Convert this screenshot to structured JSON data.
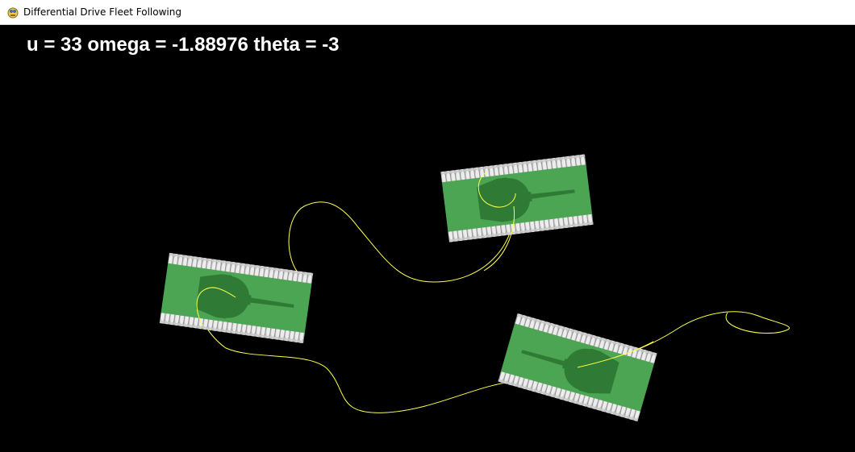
{
  "window": {
    "title": "Differential Drive Fleet Following",
    "app_icon": "pygame-snake-icon"
  },
  "hud": {
    "text": "u = 33 omega = -1.88976 theta = -3"
  },
  "colors": {
    "background": "#000000",
    "tank_body": "#4ba552",
    "tank_turret": "#2f7a35",
    "tread": "#b4b4b4",
    "tread_segment": "#8c8c8c",
    "trail": "#ffff4d",
    "hud_text": "#ffffff"
  },
  "vehicles": [
    {
      "id": "tank-1",
      "icon": "tank-icon"
    },
    {
      "id": "tank-2",
      "icon": "tank-icon"
    },
    {
      "id": "tank-3",
      "icon": "tank-icon"
    }
  ]
}
